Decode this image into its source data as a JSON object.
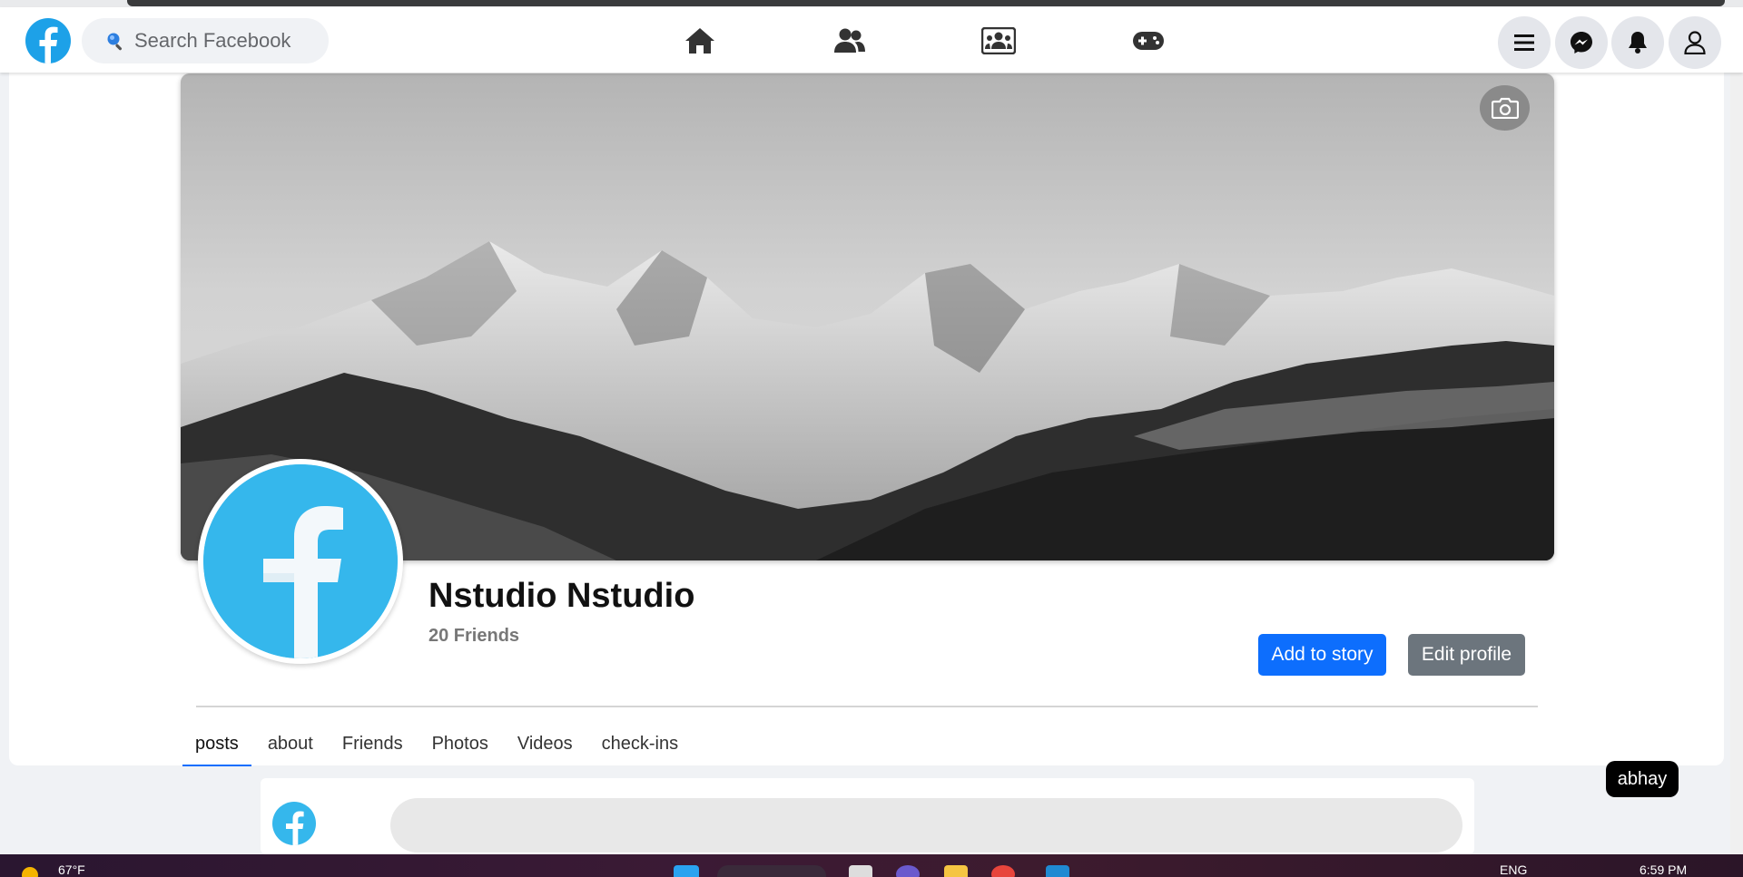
{
  "search": {
    "placeholder": "Search Facebook"
  },
  "nav": {
    "center_icons": [
      "home-icon",
      "friends-icon",
      "groups-icon",
      "gaming-icon"
    ],
    "right_buttons": [
      "menu-icon",
      "messenger-icon",
      "notifications-icon",
      "account-icon"
    ]
  },
  "profile": {
    "name": "Nstudio Nstudio",
    "friends": "20 Friends",
    "add_story_label": "Add to story",
    "edit_profile_label": "Edit profile"
  },
  "tabs": [
    {
      "label": "posts",
      "active": true
    },
    {
      "label": "about",
      "active": false
    },
    {
      "label": "Friends",
      "active": false
    },
    {
      "label": "Photos",
      "active": false
    },
    {
      "label": "Videos",
      "active": false
    },
    {
      "label": "check-ins",
      "active": false
    }
  ],
  "tooltip": {
    "text": "abhay"
  },
  "taskbar": {
    "weather": "67°F",
    "language": "ENG",
    "time": "6:59 PM"
  },
  "colors": {
    "brand": "#1da1e8",
    "primary_button": "#0d6efd",
    "secondary_button": "#6c757d"
  }
}
